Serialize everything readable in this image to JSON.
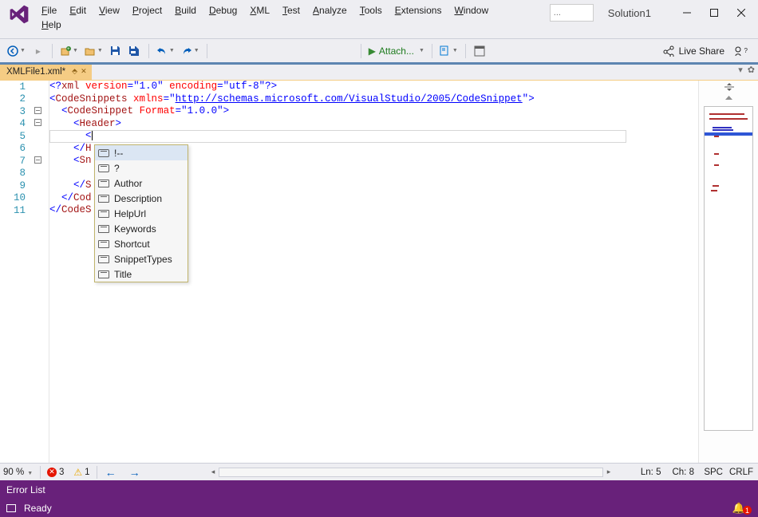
{
  "titlebar": {
    "solution_name": "Solution1",
    "menus_row1": [
      "File",
      "Edit",
      "View",
      "Project",
      "Build",
      "Debug",
      "XML",
      "Test",
      "Analyze",
      "Tools",
      "Extensions",
      "Window"
    ],
    "menus_row2": [
      "Help"
    ],
    "search_placeholder": "..."
  },
  "toolbar": {
    "attach_label": "Attach..."
  },
  "live_share": {
    "label": "Live Share"
  },
  "tab": {
    "name": "XMLFile1.xml*"
  },
  "code": {
    "lines": [
      {
        "n": 1,
        "html": "<span class='xml-delim'>&lt;?</span><span class='xml-name'>xml</span> <span class='xml-attr'>version</span><span class='xml-delim'>=</span><span class='xml-value'>\"1.0\"</span> <span class='xml-attr'>encoding</span><span class='xml-delim'>=</span><span class='xml-value'>\"utf-8\"</span><span class='xml-delim'>?&gt;</span>"
      },
      {
        "n": 2,
        "html": "<span class='xml-delim'>&lt;</span><span class='xml-name'>CodeSnippets</span> <span class='xml-attr'>xmlns</span><span class='xml-delim'>=</span><span class='xml-delim'>\"</span><span class='xml-link'>http://schemas.microsoft.com/VisualStudio/2005/CodeSnippet</span><span class='xml-delim'>\"</span><span class='xml-delim'>&gt;</span>"
      },
      {
        "n": 3,
        "fold": true,
        "html": "  <span class='xml-delim'>&lt;</span><span class='xml-name'>CodeSnippet</span> <span class='xml-attr'>Format</span><span class='xml-delim'>=</span><span class='xml-value'>\"1.0.0\"</span><span class='xml-delim'>&gt;</span>"
      },
      {
        "n": 4,
        "fold": true,
        "html": "    <span class='xml-delim'>&lt;</span><span class='xml-name'>Header</span><span class='xml-delim'>&gt;</span>"
      },
      {
        "n": 5,
        "current": true,
        "html": "      <span class='xml-delim'>&lt;</span><span class='caret-line'></span>"
      },
      {
        "n": 6,
        "html": "    <span class='xml-delim'>&lt;/</span><span class='xml-name'>H</span>"
      },
      {
        "n": 7,
        "fold": true,
        "html": "    <span class='xml-delim'>&lt;</span><span class='xml-name'>Sn</span>"
      },
      {
        "n": 8,
        "html": ""
      },
      {
        "n": 9,
        "html": "    <span class='xml-delim'>&lt;/</span><span class='xml-name'>S</span>"
      },
      {
        "n": 10,
        "html": "  <span class='xml-delim'>&lt;/</span><span class='xml-name'>Cod</span>"
      },
      {
        "n": 11,
        "html": "<span class='xml-delim'>&lt;/</span><span class='xml-name'>CodeS</span>"
      }
    ]
  },
  "intellisense": {
    "items": [
      {
        "label": "!--",
        "special": true,
        "selected": true
      },
      {
        "label": "?",
        "special": true
      },
      {
        "label": "Author"
      },
      {
        "label": "Description"
      },
      {
        "label": "HelpUrl"
      },
      {
        "label": "Keywords"
      },
      {
        "label": "Shortcut"
      },
      {
        "label": "SnippetTypes"
      },
      {
        "label": "Title"
      }
    ]
  },
  "editor_bottom": {
    "zoom": "90 %",
    "errors": "3",
    "warnings": "1",
    "ln_label": "Ln:",
    "ln": "5",
    "ch_label": "Ch:",
    "ch": "8",
    "spc": "SPC",
    "crlf": "CRLF"
  },
  "error_list": {
    "title": "Error List"
  },
  "status": {
    "text": "Ready",
    "notif_count": "1"
  }
}
